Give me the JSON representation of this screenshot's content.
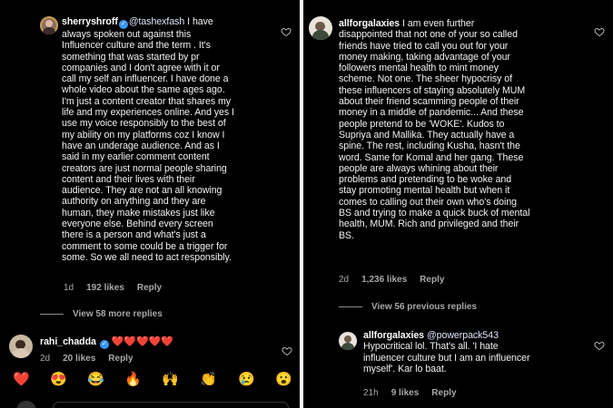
{
  "left": {
    "comment1": {
      "username": "sherryshroff",
      "mention": "@tashexfash",
      "text_lines": [
        "I have",
        "always spoken out against this",
        "Influencer culture and the term . It's",
        "something that was started by pr",
        "companies and I don't agree with it or",
        "call my self an influencer. I have done a",
        "whole video about the same ages ago.",
        "I'm just a content creator that shares my",
        "life and my experiences online. And yes I",
        "use my voice responsibly to the best of",
        "my ability on my platforms coz I know I",
        "have an underage audience. And as I",
        "said in my earlier comment content",
        "creators are just normal people sharing",
        "content and their lives with their",
        "audience. They are not an all knowing",
        "authority on anything and they are",
        "human, they make mistakes just like",
        "everyone else.  Behind every screen",
        "there is a person and what's just a",
        "comment to some could be a trigger for",
        "some. So we all need to act responsibly."
      ],
      "time": "1d",
      "likes": "192 likes",
      "reply": "Reply"
    },
    "view_more": "View 58 more replies",
    "comment2": {
      "username": "rahi_chadda",
      "hearts": "❤️❤️❤️❤️❤️",
      "time": "2d",
      "likes": "20 likes",
      "reply": "Reply"
    },
    "emojis": [
      "❤️",
      "😍",
      "😂",
      "🔥",
      "🙌",
      "👏",
      "😢",
      "😮"
    ]
  },
  "right": {
    "comment1": {
      "username": "allforgalaxies",
      "text_lines": [
        "I am even further",
        "disappointed that not one of your so called",
        "friends have tried to call you out for your",
        "money making, taking advantage of your",
        "followers mental health to mint money",
        "scheme. Not one. The sheer hypocrisy of",
        "these influencers of staying absolutely MUM",
        "about their friend scamming people of their",
        "money in a middle of pandemic... And these",
        "people pretend to be 'WOKE'. Kudos to",
        "Supriya and Mallika. They actually have a",
        "spine. The rest, including Kusha, hasn't the",
        "word. Same for Komal and her gang. These",
        "people are always whining about their",
        "problems and pretending to be woke and",
        "stay promoting mental health but when it",
        "comes to calling out their own who's doing",
        "BS and trying to make a quick buck of mental",
        "health, MUM. Rich and privileged and their",
        "BS."
      ],
      "time": "2d",
      "likes": "1,236 likes",
      "reply": "Reply"
    },
    "view_previous": "View 56 previous replies",
    "comment2": {
      "username": "allforgalaxies",
      "mention": "@powerpack543",
      "text_lines": [
        "Hypocritical lol.  That's all. 'I hate",
        "influencer culture but I am an influencer",
        "myself'. Kar lo baat."
      ],
      "time": "21h",
      "likes": "9 likes",
      "reply": "Reply"
    }
  }
}
